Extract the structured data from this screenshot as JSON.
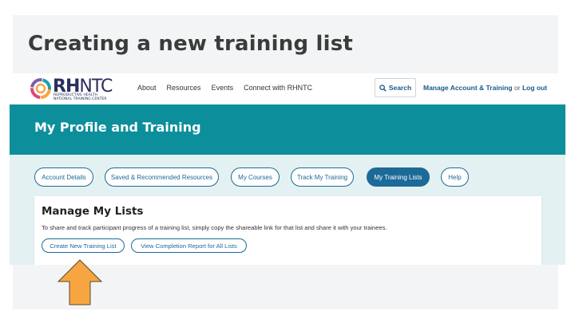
{
  "slide": {
    "title": "Creating a new training list"
  },
  "site": {
    "logo_text_bold": "RH",
    "logo_text_light": "NTC",
    "logo_sub_line1": "REPRODUCTIVE HEALTH",
    "logo_sub_line2": "NATIONAL TRAINING CENTER",
    "nav": [
      "About",
      "Resources",
      "Events",
      "Connect with RHNTC"
    ],
    "search_label": "Search",
    "account_label": "Manage Account & Training",
    "or_label": "or",
    "logout_label": "Log out"
  },
  "banner": {
    "title": "My Profile and Training"
  },
  "tabs": [
    {
      "label": "Account Details",
      "active": false
    },
    {
      "label": "Saved & Recommended Resources",
      "active": false
    },
    {
      "label": "My Courses",
      "active": false
    },
    {
      "label": "Track My Training",
      "active": false
    },
    {
      "label": "My Training Lists",
      "active": true
    },
    {
      "label": "Help",
      "active": false
    }
  ],
  "manage": {
    "heading": "Manage My Lists",
    "description": "To share and track participant progress of a training list, simply copy the shareable link for that list and share it with your trainees.",
    "create_button": "Create New Training List",
    "report_button": "View Completion Report for All Lists"
  },
  "colors": {
    "teal_banner": "#0d8f9b",
    "accent_blue": "#1c6a98",
    "arrow_fill": "#f7a541"
  }
}
